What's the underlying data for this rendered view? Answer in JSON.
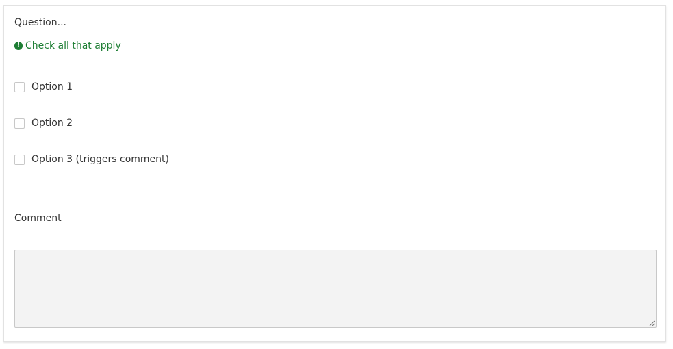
{
  "question": {
    "title": "Question...",
    "hint": "Check all that apply",
    "hint_icon": "exclamation-circle-icon",
    "options": [
      {
        "label": "Option 1",
        "checked": false
      },
      {
        "label": "Option 2",
        "checked": false
      },
      {
        "label": "Option 3 (triggers comment)",
        "checked": false
      }
    ]
  },
  "comment": {
    "label": "Comment",
    "value": ""
  },
  "colors": {
    "hint": "#1e7e34",
    "text": "#333333",
    "textarea_bg": "#f3f3f3",
    "border": "#c8c8c8"
  }
}
